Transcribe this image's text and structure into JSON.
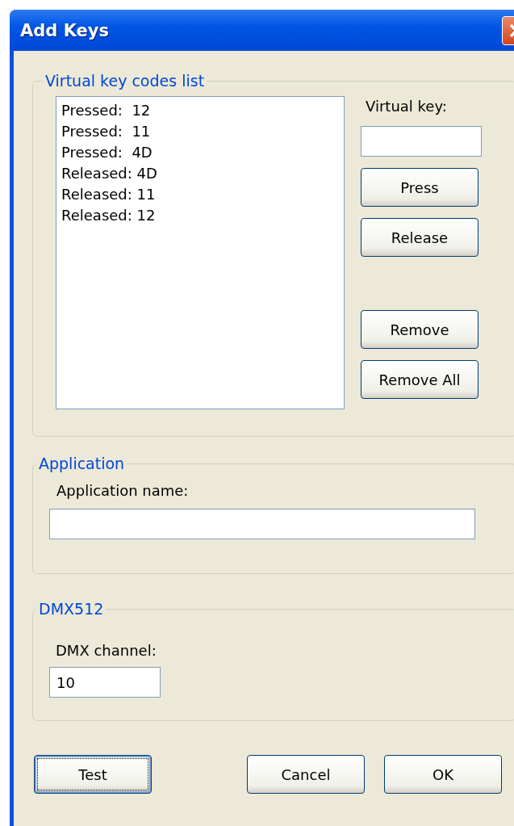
{
  "window": {
    "title": "Add Keys"
  },
  "key_codes_group": {
    "title": "Virtual key codes list",
    "list": [
      "Pressed:  12",
      "Pressed:  11",
      "Pressed:  4D",
      "Released: 4D",
      "Released: 11",
      "Released: 12"
    ],
    "virtual_key": {
      "label": "Virtual key:"
    },
    "key_buttons": [
      "Press",
      "Release"
    ],
    "remove_buttons": [
      "Remove",
      "Remove All"
    ]
  },
  "application_group": {
    "title": "Application",
    "field": {
      "label": "Application name:"
    }
  },
  "dmx_group": {
    "title": "DMX512",
    "field": {
      "label": "DMX channel:",
      "value": "10"
    }
  },
  "footer_buttons": [
    {
      "label": "Test",
      "focused": true
    },
    {
      "label": "Cancel",
      "focused": false
    },
    {
      "label": "OK",
      "focused": false
    }
  ]
}
